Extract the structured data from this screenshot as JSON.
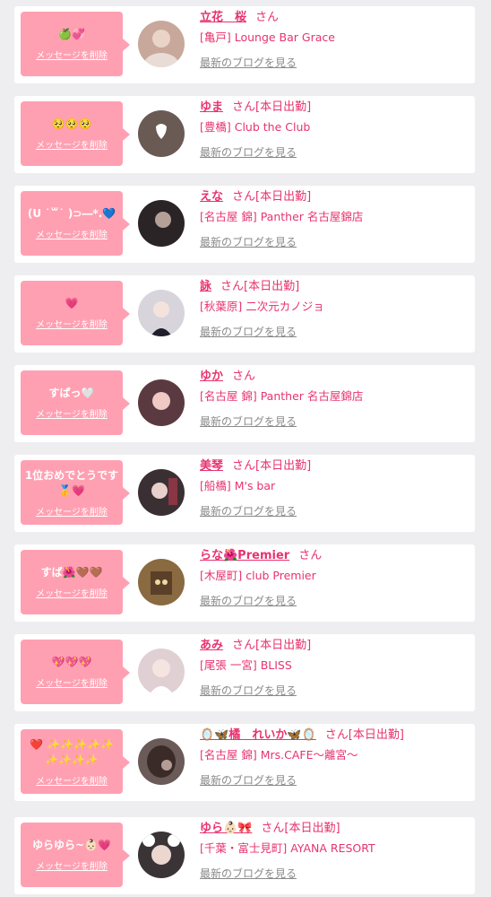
{
  "cards": [
    {
      "message": "🍏💞",
      "delete_label": "メッセージを削除",
      "name": "立花　桜",
      "suffix": "さん",
      "shop": "[亀戸] Lounge Bar Grace",
      "blog_label": "最新のブログを見る",
      "avatar_color": "#c8a89a"
    },
    {
      "message": "🥺🥺🥺",
      "delete_label": "メッセージを削除",
      "name": "ゆま",
      "suffix": "さん[本日出勤]",
      "shop": "[豊橋] Club the Club",
      "blog_label": "最新のブログを見る",
      "avatar_color": "#6a5a54"
    },
    {
      "message": "(U ˙꒳˙ )⊃―*.💙",
      "delete_label": "メッセージを削除",
      "name": "えな",
      "suffix": "さん[本日出勤]",
      "shop": "[名古屋 錦] Panther 名古屋錦店",
      "blog_label": "最新のブログを見る",
      "avatar_color": "#2a2426"
    },
    {
      "message": "💗",
      "delete_label": "メッセージを削除",
      "name": "詠",
      "suffix": "さん[本日出勤]",
      "shop": "[秋葉原] 二次元カノジョ",
      "blog_label": "最新のブログを見る",
      "avatar_color": "#d8d4dc"
    },
    {
      "message": "すぱっ🤍",
      "delete_label": "メッセージを削除",
      "name": "ゆか",
      "suffix": "さん",
      "shop": "[名古屋 錦] Panther 名古屋錦店",
      "blog_label": "最新のブログを見る",
      "avatar_color": "#5a3a40"
    },
    {
      "message": "1位おめでとうです🥇💗",
      "delete_label": "メッセージを削除",
      "name": "美琴",
      "suffix": "さん[本日出勤]",
      "shop": "[船橋] M's bar",
      "blog_label": "最新のブログを見る",
      "avatar_color": "#3a3034"
    },
    {
      "message": "すば🌺🤎🤎",
      "delete_label": "メッセージを削除",
      "name": "らな🌺Premier",
      "suffix": "さん",
      "shop": "[木屋町] club Premier",
      "blog_label": "最新のブログを見る",
      "avatar_color": "#8a6a40"
    },
    {
      "message": "💖💖💖",
      "delete_label": "メッセージを削除",
      "name": "あみ",
      "suffix": "さん[本日出勤]",
      "shop": "[尾張 一宮] BLISS",
      "blog_label": "最新のブログを見る",
      "avatar_color": "#e0d0d4"
    },
    {
      "message": "❤️ ✨✨✨✨✨ ✨✨✨✨",
      "delete_label": "メッセージを削除",
      "name": "🪞🦋橘　れいか🦋🪞",
      "suffix": "さん[本日出勤]",
      "shop": "[名古屋 錦] Mrs.CAFE〜離宮〜",
      "blog_label": "最新のブログを見る",
      "avatar_color": "#6a5a58"
    },
    {
      "message": "ゆらゆら~👶🏻💗",
      "delete_label": "メッセージを削除",
      "name": "ゆら👶🏻🎀",
      "suffix": "さん[本日出勤]",
      "shop": "[千葉・富士見町] AYANA RESORT",
      "blog_label": "最新のブログを見る",
      "avatar_color": "#3a3436"
    }
  ]
}
